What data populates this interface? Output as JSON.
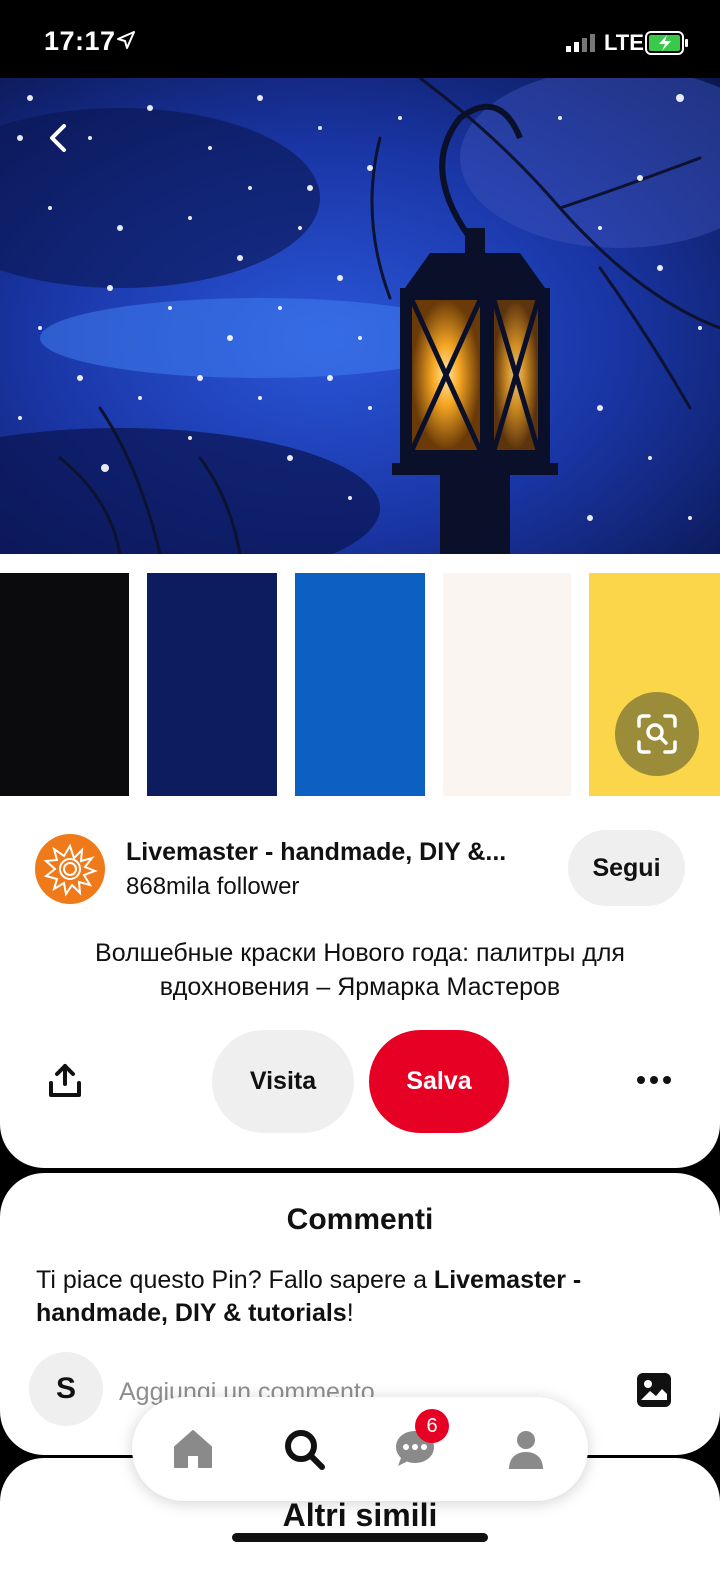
{
  "status_bar": {
    "time": "17:17",
    "network": "LTE"
  },
  "palette": {
    "colors": [
      "#0b0b0d",
      "#0c1c5e",
      "#0b60c2",
      "#fbf5f1",
      "#fcd64a"
    ]
  },
  "pin": {
    "creator": {
      "name": "Livemaster - handmade, DIY &...",
      "followers": "868mila follower",
      "follow_label": "Segui"
    },
    "description": "Волшебные краски Нового года: палитры для вдохновения – Ярмарка Мастеров",
    "actions": {
      "visit_label": "Visita",
      "save_label": "Salva"
    }
  },
  "comments": {
    "title": "Commenti",
    "prompt_prefix": "Ti piace questo Pin? Fallo sapere a ",
    "prompt_name": "Livemaster - handmade, DIY & tutorials",
    "prompt_suffix": "!",
    "user_initial": "S",
    "input_placeholder": "Aggiungi un commento"
  },
  "more": {
    "title": "Altri simili"
  },
  "nav": {
    "items": [
      "home-icon",
      "search-icon",
      "messages-icon",
      "profile-icon"
    ],
    "messages_badge": "6"
  }
}
